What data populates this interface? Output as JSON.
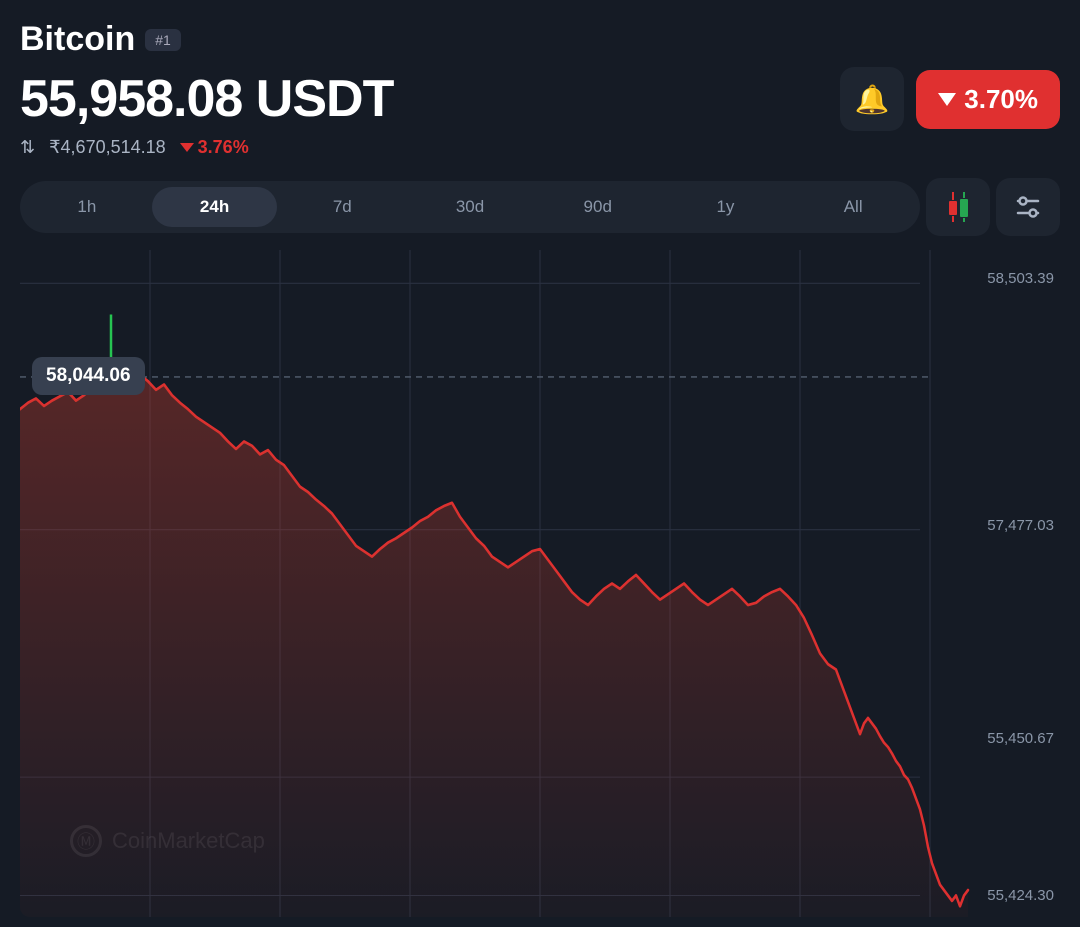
{
  "header": {
    "coin_name": "Bitcoin",
    "rank": "#1",
    "price": "55,958.08 USDT",
    "inr_price": "₹4,670,514.18",
    "change_pct_inr": "3.76%",
    "change_pct_usd": "3.70%",
    "bell_icon": "🔔"
  },
  "timeframes": [
    {
      "label": "1h",
      "active": false
    },
    {
      "label": "24h",
      "active": true
    },
    {
      "label": "7d",
      "active": false
    },
    {
      "label": "30d",
      "active": false
    },
    {
      "label": "90d",
      "active": false
    },
    {
      "label": "1y",
      "active": false
    },
    {
      "label": "All",
      "active": false
    }
  ],
  "chart": {
    "y_labels": [
      {
        "value": "58,503.39",
        "pct": 5
      },
      {
        "value": "57,477.03",
        "pct": 42
      },
      {
        "value": "55,450.67",
        "pct": 79
      },
      {
        "value": "55,424.30",
        "pct": 97
      }
    ],
    "current_label": "58,044.06",
    "current_label_top_pct": 19,
    "watermark": "CoinMarketCap"
  }
}
